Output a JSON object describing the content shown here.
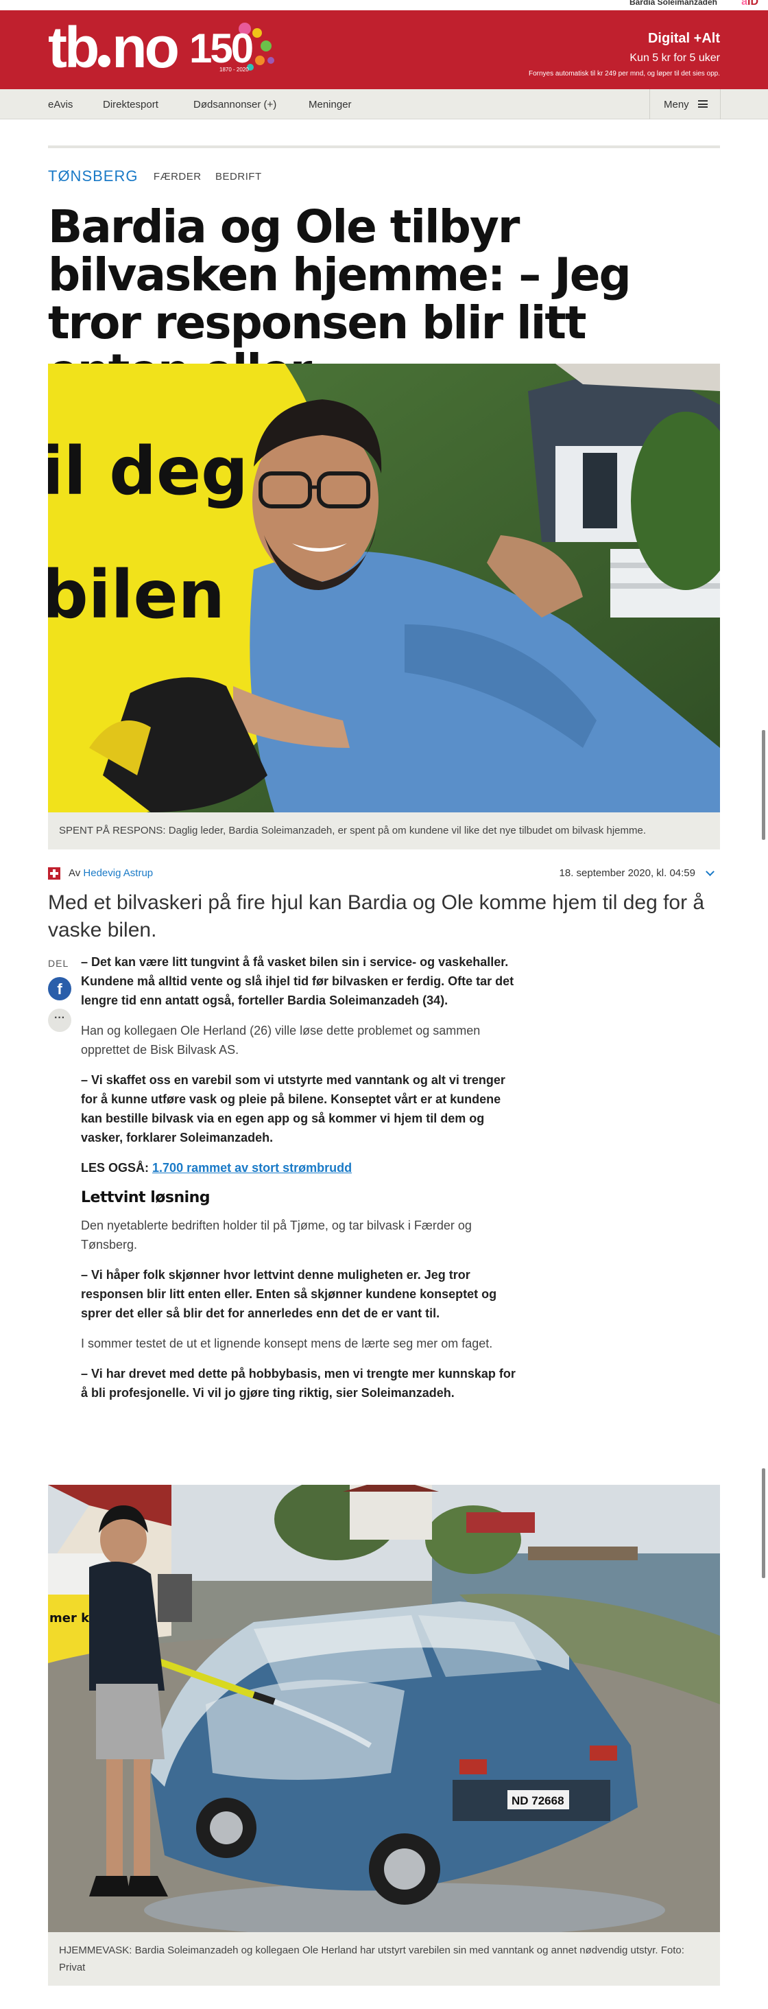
{
  "topbar": {
    "user_name": "Bardia Soleimanzadeh",
    "aid_logo": "aID"
  },
  "masthead": {
    "logo_text_left": "tb",
    "logo_text_right": "no",
    "jubilee_number": "150",
    "jubilee_years": "1870 - 2020",
    "promo_title": "Digital +Alt",
    "promo_offer": "Kun 5 kr for 5 uker",
    "promo_fineprint": "Fornyes automatisk til kr 249 per mnd, og løper til det sies opp.",
    "brand_color": "#c0202e"
  },
  "nav": {
    "items": [
      "eAvis",
      "Direktesport",
      "Dødsannonser (+)",
      "Meninger"
    ],
    "menu_label": "Meny"
  },
  "article": {
    "section": "TØNSBERG",
    "tags": [
      "FÆRDER",
      "BEDRIFT"
    ],
    "headline": "Bardia og Ole tilbyr bilvasken hjemme: – Jeg tror responsen blir litt enten eller",
    "photo1_caption": "SPENT PÅ RESPONS: Daglig leder, Bardia Soleimanzadeh, er spent på om kundene vil like det nye tilbudet om bilvask hjemme.",
    "photo1_sign_text_1": "il deg",
    "photo1_sign_text_2": "bilen",
    "byline_prefix": "Av",
    "author": "Hedevig Astrup",
    "date": "18. september 2020, kl. 04:59",
    "lead": "Med et bilvaskeri på fire hjul kan Bardia og Ole komme hjem til deg for å vaske bilen.",
    "share_label": "DEL",
    "share_more": "···",
    "paragraphs": [
      "– Det kan være litt tungvint å få vasket bilen sin i service- og vaskehaller. Kundene må alltid vente og slå ihjel tid før bilvasken er ferdig. Ofte tar det lengre tid enn antatt også, forteller Bardia Soleimanzadeh (34).",
      "Han og kollegaen Ole Herland (26) ville løse dette problemet og sammen opprettet de Bisk Bilvask AS.",
      "– Vi skaffet oss en varebil som vi utstyrte med vanntank og alt vi trenger for å kunne utføre vask og pleie på bilene. Konseptet vårt er at kundene kan bestille bilvask via en egen app og så kommer vi hjem til dem og vasker, forklarer Soleimanzadeh.",
      "Den nyetablerte bedriften holder til på Tjøme, og tar bilvask i Færder og Tønsberg.",
      "– Vi håper folk skjønner hvor lettvint denne muligheten er. Jeg tror responsen blir litt enten eller. Enten så skjønner kundene konseptet og sprer det eller så blir det for annerledes enn det de er vant til.",
      "I sommer testet de ut et lignende konsept mens de lærte seg mer om faget.",
      "– Vi har drevet med dette på hobbybasis, men vi trengte mer kunnskap for å bli profesjonelle. Vi vil jo gjøre ting riktig, sier Soleimanzadeh."
    ],
    "also_label": "LES OGSÅ:",
    "also_link": "1.700 rammet av stort strømbrudd",
    "subheading": "Lettvint løsning",
    "photo2_plate": "ND 72668",
    "photo2_van_text": "mer\nkes",
    "photo2_caption": "HJEMMEVASK: Bardia Soleimanzadeh og kollegaen Ole Herland har utstyrt varebilen sin med vanntank og annet nødvendig utstyr. Foto: Privat",
    "link_color": "#1a7ac7"
  }
}
